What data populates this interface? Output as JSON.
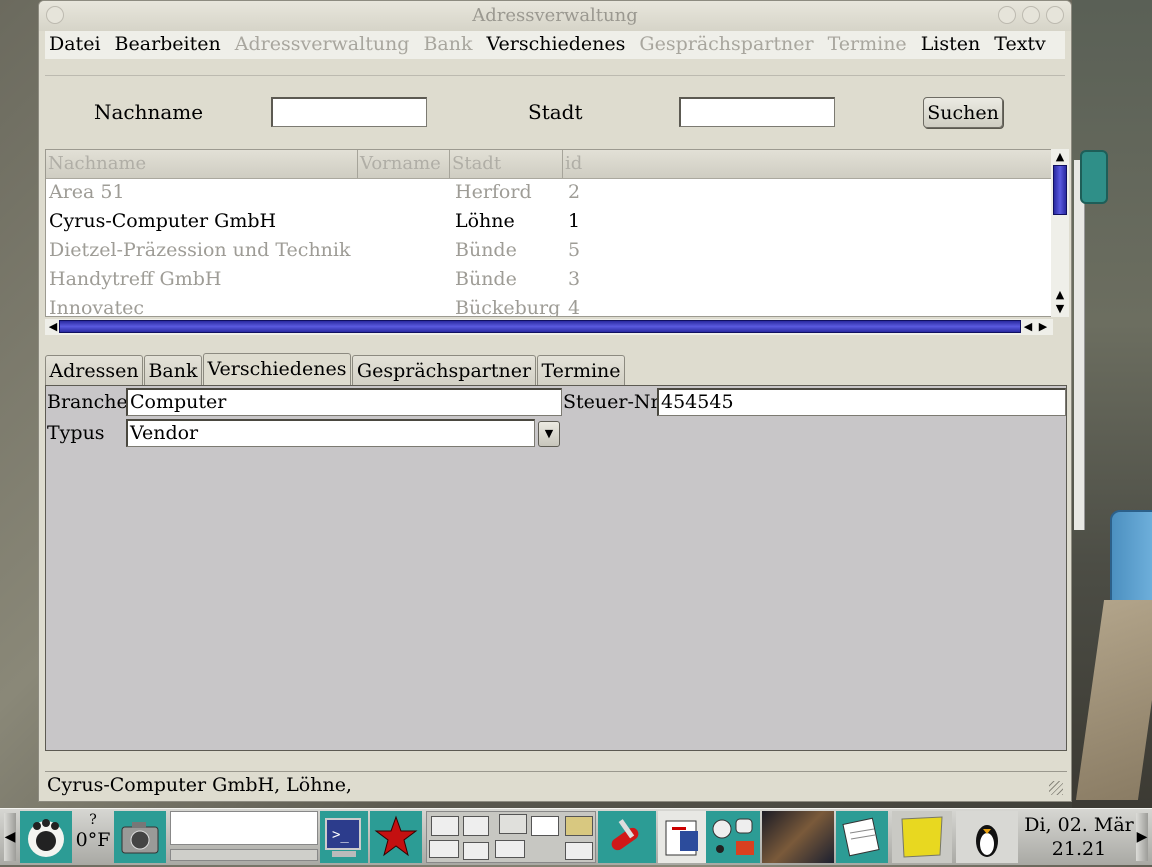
{
  "window": {
    "title": "Adressverwaltung"
  },
  "menu": [
    {
      "label": "Datei",
      "enabled": true
    },
    {
      "label": "Bearbeiten",
      "enabled": true
    },
    {
      "label": "Adressverwaltung",
      "enabled": false
    },
    {
      "label": "Bank",
      "enabled": false
    },
    {
      "label": "Verschiedenes",
      "enabled": true
    },
    {
      "label": "Gesprächspartner",
      "enabled": false
    },
    {
      "label": "Termine",
      "enabled": false
    },
    {
      "label": "Listen",
      "enabled": true
    },
    {
      "label": "Textv",
      "enabled": true
    }
  ],
  "search": {
    "nachname_label": "Nachname",
    "nachname_value": "",
    "stadt_label": "Stadt",
    "stadt_value": "",
    "button_label": "Suchen"
  },
  "table": {
    "columns": [
      "Nachname",
      "Vorname",
      "Stadt",
      "id"
    ],
    "rows": [
      {
        "nachname": "Area 51",
        "vorname": "",
        "stadt": "Herford",
        "id": "2",
        "selected": false
      },
      {
        "nachname": "Cyrus-Computer GmbH",
        "vorname": "",
        "stadt": "Löhne",
        "id": "1",
        "selected": true
      },
      {
        "nachname": "Dietzel-Präzession und Technik",
        "vorname": "",
        "stadt": "Bünde",
        "id": "5",
        "selected": false
      },
      {
        "nachname": "Handytreff GmbH",
        "vorname": "",
        "stadt": "Bünde",
        "id": "3",
        "selected": false
      },
      {
        "nachname": "Innovatec",
        "vorname": "",
        "stadt": "Bückeburg",
        "id": "4",
        "selected": false
      }
    ]
  },
  "tabs": [
    {
      "label": "Adressen",
      "active": false
    },
    {
      "label": "Bank",
      "active": false
    },
    {
      "label": "Verschiedenes",
      "active": true
    },
    {
      "label": "Gesprächspartner",
      "active": false
    },
    {
      "label": "Termine",
      "active": false
    }
  ],
  "form": {
    "branche_label": "Branche",
    "branche_value": "Computer",
    "steuer_label": "Steuer-Nr",
    "steuer_value": "454545",
    "typus_label": "Typus",
    "typus_value": "Vendor"
  },
  "status": {
    "text": "Cyrus-Computer GmbH, Löhne,"
  },
  "taskbar": {
    "weather_symbol": "?",
    "temperature": "0°F",
    "date": "Di, 02. Mär",
    "time": "21.21",
    "launchers": [
      "gnome-foot-icon",
      "camera-icon",
      "terminal-icon",
      "star-icon",
      "pager-icon",
      "swiss-knife-icon",
      "office-icon",
      "shapes-icon",
      "nebula-icon",
      "notepad-icon",
      "sticky-note-icon",
      "penguin-icon"
    ]
  }
}
